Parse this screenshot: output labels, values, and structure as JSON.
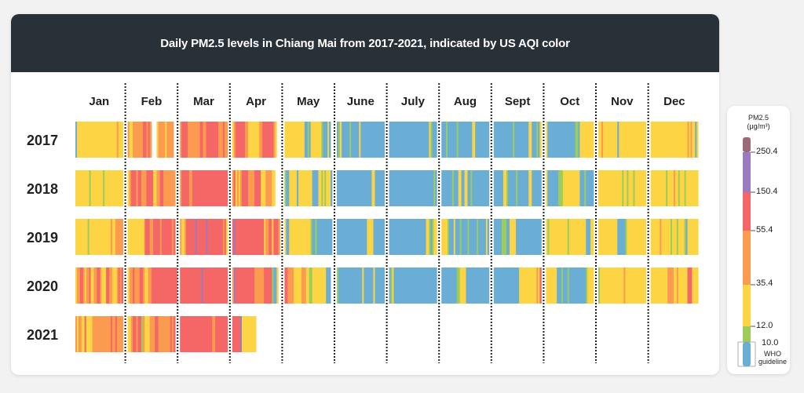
{
  "chart_data": {
    "type": "heatmap",
    "title": "Daily PM2.5 levels in Chiang Mai from 2017-2021, indicated by US AQI color",
    "months": [
      "Jan",
      "Feb",
      "Mar",
      "Apr",
      "May",
      "June",
      "July",
      "Aug",
      "Sept",
      "Oct",
      "Nov",
      "Dec"
    ],
    "years": [
      "2017",
      "2018",
      "2019",
      "2020",
      "2021"
    ],
    "category_key": {
      "B": "0-10.0 (WHO guideline)",
      "G": "10.0-12.0",
      "Y": "12.0-35.4",
      "O": "35.4-55.4",
      "R": "55.4-150.4",
      "P": "150.4-250.4",
      "M": ">250.4",
      "_": "no data"
    },
    "colors": {
      "B": "#6aaed6",
      "G": "#9ccc5a",
      "Y": "#fdd444",
      "O": "#fb9b50",
      "R": "#f56666",
      "P": "#9b7bbf",
      "M": "#9a6a78"
    },
    "daily_categories": {
      "2017": [
        "BYYYYYYYYYYYYYYYYYYYYYYYYYYOYYY",
        "OYYOOOOOORRORO___YOOOOYOOOO",
        "ORRRROOOOOOOORROORRRRRRRROOOROO",
        "YORRRRRROOYYYYYYYOORRRRRRROY",
        "YYYYYYYYYYYYYBBGBYYYYYYYGBBBYB",
        "BGYBBBBBGBBBBBYBBBBBBBBBBBBBBB",
        "BBBBBBBBBBBBBBBBBBBBBBBBBBYGBBB",
        "BBBGBBBBBBGBBBBBBBBBYYBBBBBBBBB",
        "BBBBBBBBBBBBGBBBBBBBBBYYBBBGBY",
        "YBBBBBBBBBBBBBBBBBBGGBYYYYYYYYY",
        "YYOYYYYYYYYYBYYYYYYYYYYYYYYYYY",
        "YYYYYYYYYYYYYYYYYYYYYYYYOYOYYBY"
      ],
      "2018": [
        "YYYYYYYYYGYYYYYYYYGYYYYYYYYYYYY",
        "YORRRORROOORRRRYYOORROOOOOOO",
        "ORRRRROORRRRRRRRRRRRRRRRRRRRRRR",
        "ORYOYORRRROOOORRRRYYYOOOOYY",
        "GBBYYYYYBYYYYYYYYYBBBBYYGYGYYYB",
        "BBBBBBBBBBBBBBBBBBBBBBYYBBBBBB",
        "BBBBBBBBBBBBBBBBBBBBBBBBBBBBBGB",
        "BBBBBBBGBBBYYBBYYBBGBBBBBBBBBBB",
        "BBBBBBYYGBBBBBGBBBBBBBYYBBBBBB",
        "YBBBBBBBGGGYYYYYYYYYYYBBBGBBBBB",
        "YYYYYYYYYYYYYYYGYYGYYYGYYYYYYY",
        "YYYYYYYYYYGYYYYOYYGYYYGYYYYYYYY"
      ],
      "2019": [
        "YYYYYYYYGYYYYYYYYYYYYYYOYYOOOOO",
        "YYYYYYYYYYRRROORRRRORRRRRROR",
        "OYYORRRRRRPRRRRRRPRRRRRRRRRRORY",
        "RPRRRRRRRRRRRRRRRRRRYOORRYRRRO",
        "YBBYYYYYYYYYYYYYYGBBGBBBBBBBBBB",
        "BBBBBBBBBBBBBBBBBBBYYYYBBBBBBB",
        "BBBBBBBBBBBBBBBBBBBBBBBBYYGBGYY",
        "YYYYGBBBYBBBGBBBBGBBBBBGBBBBBYB",
        "BBBBBGGGBBYYYYBBBBBBBBBBBBBBBB",
        "YGYYYYYYYYYYYYGYYYYYYYYYYYBBBYY",
        "YYYYYYYYYYYYBBBBBGYYYYYYYYYYYY",
        "YYYYYYOYYYYYYGYYYGYYYYGBYYYYYYY"
      ],
      "2020": [
        "YOORROYOORYYOORROYYYRROOYYYOROR",
        "YOOROOORROYYOORRRRRRRRRRRRRRR",
        "RRRRRRRRRRRRRRPRRRRRRRRRRRRRRRR",
        "OPRRRRRRRRRRRROOOOOORRRRRGBBY",
        "RROOOOYYYYYOOOYYGGYYYYYYYYYBBB",
        "GBBBBBBBBBBBBBBBYBBBBBBYBBBBBB",
        "BGYBBBBBBBBBBBBBBBBBBBBBBBBBBBB",
        "BBBBBBBBBBGGYYYYBBBBBBBBBBBBBBB",
        "BBBBBBBBBBBBBBBBYYYYYYYYYYYOYR",
        "YYYYYYYBBBGBBBGBBBBBBBBBBBGYYYY",
        "GYYYYYYYYYYYYYYYOYYYYYYYYYYYYY",
        "YYYYYYYYYYYOOOOYYOYYYYYYRRRYYYY"
      ],
      "2021": [
        "OYOOYYRYYYYOOOOOOOOOOOOROOROOOO",
        "YYORRORRGOYYYOOORROOOOOOOROR",
        "RRRRRRRRRRRRRRRRRRRRROORRRRRRRR",
        "RRRRRPYYYYYYYYY"
      ]
    },
    "legend": {
      "title_line1": "PM2.5",
      "title_line2": "(μg/m³)",
      "ticks": [
        "250.4",
        "150.4",
        "55.4",
        "35.4",
        "12.0",
        "10.0"
      ],
      "who_line1": "WHO",
      "who_line2": "guideline"
    }
  }
}
